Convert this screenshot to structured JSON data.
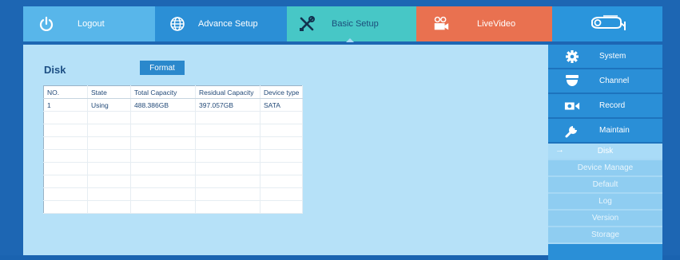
{
  "topnav": {
    "tabs": [
      {
        "label": "Logout"
      },
      {
        "label": "Advance Setup"
      },
      {
        "label": "Basic Setup"
      },
      {
        "label": "LiveVideo"
      }
    ]
  },
  "main": {
    "title": "Disk",
    "format_label": "Format",
    "table": {
      "headers": [
        "NO.",
        "State",
        "Total Capacity",
        "Residual Capacity",
        "Device type"
      ],
      "rows": [
        [
          "1",
          "Using",
          "488.386GB",
          "397.057GB",
          "SATA"
        ]
      ]
    }
  },
  "sidebar": {
    "sections": [
      {
        "label": "System",
        "icon": "gear-icon"
      },
      {
        "label": "Channel",
        "icon": "dome-camera-icon"
      },
      {
        "label": "Record",
        "icon": "video-record-icon"
      },
      {
        "label": "Maintain",
        "icon": "wrench-icon"
      }
    ],
    "sub_items": [
      {
        "label": "Disk",
        "active": true
      },
      {
        "label": "Device Manage"
      },
      {
        "label": "Default"
      },
      {
        "label": "Log"
      },
      {
        "label": "Version"
      },
      {
        "label": "Storage"
      }
    ]
  },
  "colors": {
    "frame": "#1d66b3",
    "content_bg": "#b6e1f8",
    "logout_tab": "#58b6ea",
    "advance_tab": "#2b8fd6",
    "basic_tab": "#47c7c6",
    "live_tab": "#e97150"
  }
}
